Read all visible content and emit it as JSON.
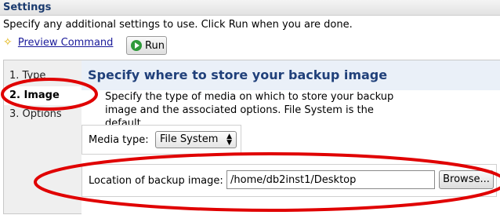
{
  "header": {
    "title": "Settings"
  },
  "instructions": "Specify any additional settings to use. Click Run when you are done.",
  "toolbar": {
    "preview_label": "Preview Command",
    "run_label": "Run"
  },
  "steps": [
    {
      "label": "1. Type"
    },
    {
      "label": "2. Image"
    },
    {
      "label": "3. Options"
    }
  ],
  "main": {
    "title": "Specify where to store your backup image",
    "description": "Specify the type of media on which to store your backup image and the associated options. File System is the default.",
    "media_label": "Media type:",
    "media_value": "File System",
    "location_label": "Location of backup image:",
    "location_value": "/home/db2inst1/Desktop",
    "browse_label": "Browse..."
  },
  "colors": {
    "annotation": "#e00000",
    "title_text": "#20407a",
    "run_icon": "#2f9a3a"
  },
  "icons": [
    "star-icon",
    "run-icon",
    "select-arrows-icon"
  ]
}
